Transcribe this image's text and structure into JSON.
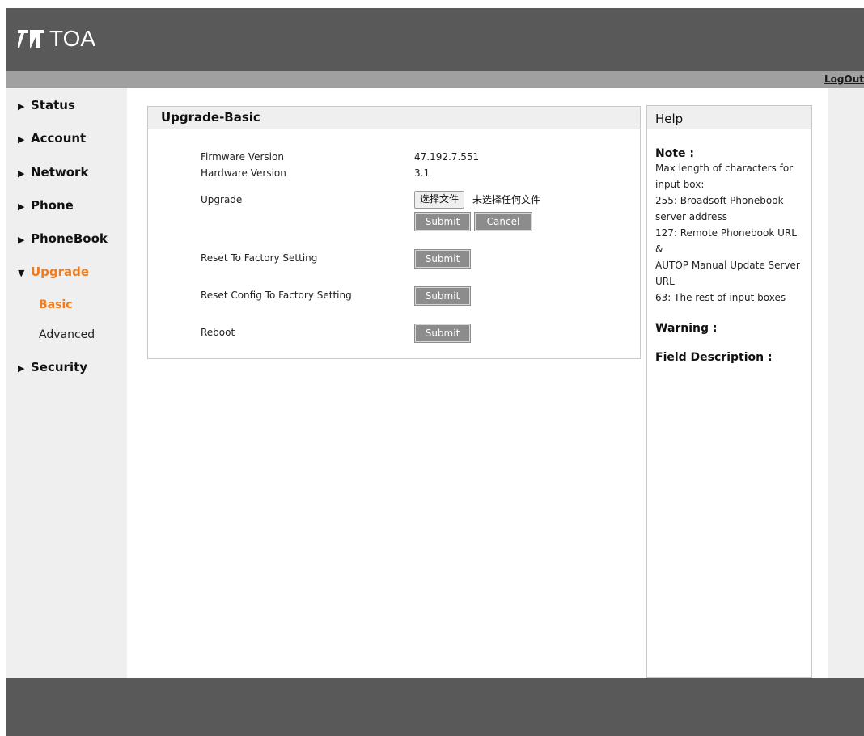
{
  "header": {
    "logo_text": "TOA",
    "logout_label": "LogOut"
  },
  "sidebar": {
    "items": [
      {
        "label": "Status",
        "expanded": false
      },
      {
        "label": "Account",
        "expanded": false
      },
      {
        "label": "Network",
        "expanded": false
      },
      {
        "label": "Phone",
        "expanded": false
      },
      {
        "label": "PhoneBook",
        "expanded": false
      },
      {
        "label": "Upgrade",
        "expanded": true
      },
      {
        "label": "Security",
        "expanded": false
      }
    ],
    "upgrade_sub": [
      {
        "label": "Basic",
        "selected": true
      },
      {
        "label": "Advanced",
        "selected": false
      }
    ]
  },
  "panel": {
    "title": "Upgrade-Basic",
    "firmware_label": "Firmware Version",
    "firmware_value": "47.192.7.551",
    "hardware_label": "Hardware Version",
    "hardware_value": "3.1",
    "upgrade_label": "Upgrade",
    "file_button": "选择文件",
    "file_status": "未选择任何文件",
    "submit_label": "Submit",
    "cancel_label": "Cancel",
    "reset_factory_label": "Reset To Factory Setting",
    "reset_config_label": "Reset Config To Factory Setting",
    "reboot_label": "Reboot"
  },
  "help": {
    "title": "Help",
    "note_head": "Note :",
    "note_lines": [
      "Max length of characters for",
      "input box:",
      "255: Broadsoft Phonebook",
      "server address",
      "127: Remote Phonebook URL &",
      "AUTOP Manual Update Server",
      "URL",
      "63: The rest of input boxes"
    ],
    "warning_head": "Warning :",
    "field_desc_head": "Field Description :"
  },
  "colors": {
    "header": "#595959",
    "subbar": "#a0a0a0",
    "sidebar": "#efefef",
    "accent": "#f07c1e",
    "button": "#8c8c8c"
  },
  "icons": {
    "nav_collapsed": "triangle-right-icon",
    "nav_expanded": "triangle-down-icon",
    "logo": "toa-logo-icon"
  }
}
